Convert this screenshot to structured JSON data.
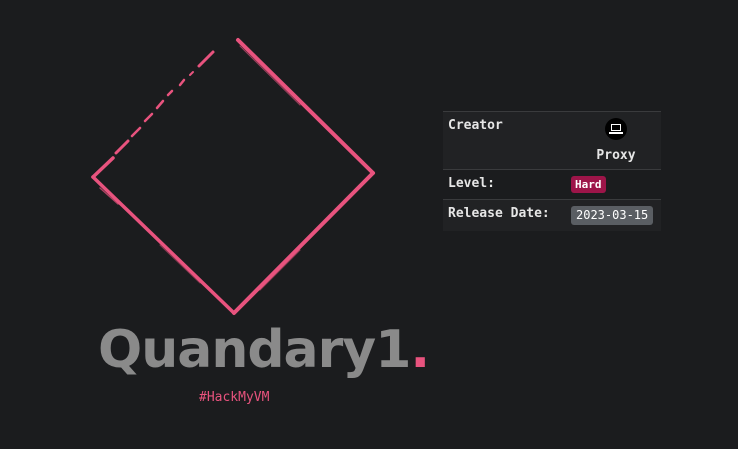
{
  "machine": {
    "name": "Quandary1",
    "name_suffix": ".",
    "hashtag": "#HackMyVM"
  },
  "info": {
    "creator_label": "Creator",
    "creator_name": "Proxy",
    "level_label": "Level:",
    "level_value": "Hard",
    "release_label": "Release Date:",
    "release_value": "2023-03-15"
  },
  "colors": {
    "accent": "#e8537e",
    "background": "#1b1c1e",
    "badge_hard": "#9d1549",
    "badge_date": "#5a5e63"
  },
  "icons": {
    "logo": "diamond-logo-icon",
    "avatar": "laptop-avatar-icon"
  }
}
